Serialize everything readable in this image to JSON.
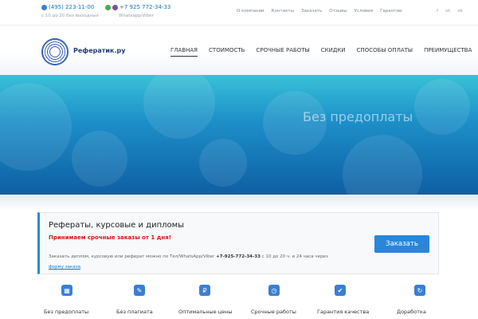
{
  "topbar": {
    "phone1": {
      "number": "(495) 223-11-00",
      "hours": "с 10 до 20 без выходных"
    },
    "phone2": {
      "number": "+7 925 772-34-33",
      "messengers": "Whatsapp/Viber"
    },
    "links": [
      "О компании",
      "Контакты",
      "Заказать",
      "Отзывы",
      "Условия",
      "Гарантии"
    ],
    "social": [
      "f",
      "vk",
      "ok"
    ]
  },
  "header": {
    "logo_text": "Рефератик.ру",
    "nav": [
      {
        "label": "ГЛАВНАЯ",
        "active": true
      },
      {
        "label": "СТОИМОСТЬ"
      },
      {
        "label": "СРОЧНЫЕ РАБОТЫ"
      },
      {
        "label": "СКИДКИ"
      },
      {
        "label": "СПОСОБЫ ОПЛАТЫ"
      },
      {
        "label": "ПРЕИМУЩЕСТВА"
      }
    ]
  },
  "banner": {
    "text": "Без предоплаты"
  },
  "infobox": {
    "title": "Рефераты, курсовые и дипломы",
    "highlight": "Принимаем срочные заказы от 1 дня!",
    "body_start": "Заказать диплом, курсовую или реферат можно по Тел/WhatsApp/Viber ",
    "body_phone": "+7-925-772-34-33",
    "body_end": " с 10 до 20 ч. и 24 часа через",
    "body_link": "форму заказа",
    "body_tail": ".",
    "button_label": "Заказать"
  },
  "features": [
    {
      "label": "Без предоплаты",
      "icon": "calculator-icon",
      "glyph": "▦"
    },
    {
      "label": "Без плагиата",
      "icon": "pencil-icon",
      "glyph": "✎"
    },
    {
      "label": "Оптимальные цены",
      "icon": "ruble-icon",
      "glyph": "₽"
    },
    {
      "label": "Срочные работы",
      "icon": "clock-icon",
      "glyph": "◷"
    },
    {
      "label": "Гарантия качества",
      "icon": "thumbs-up-icon",
      "glyph": "✔"
    },
    {
      "label": "Доработка",
      "icon": "refresh-icon",
      "glyph": "↻"
    }
  ]
}
